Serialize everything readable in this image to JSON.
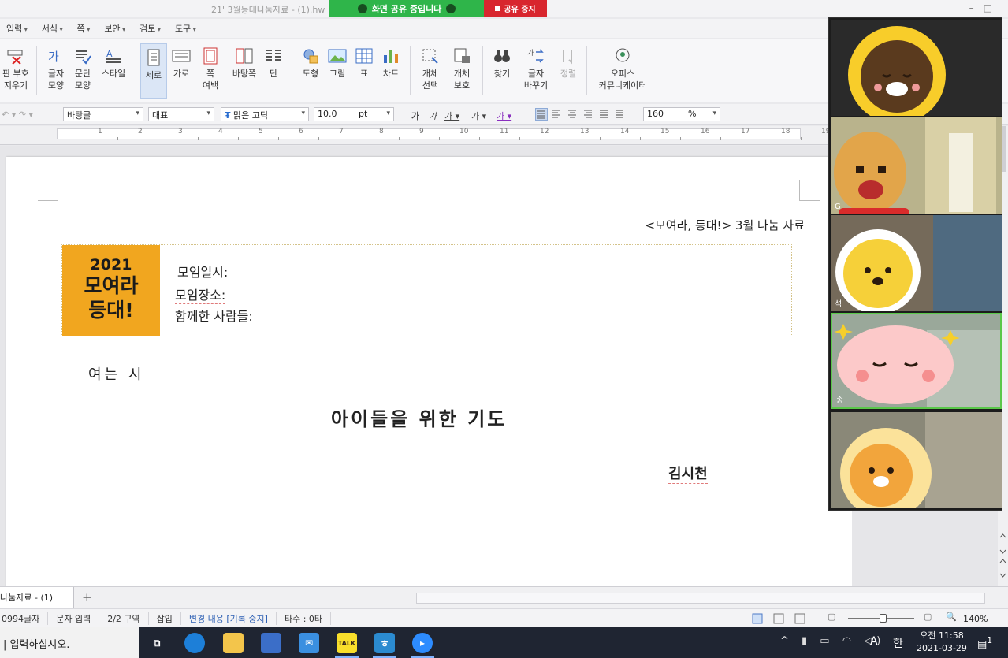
{
  "titlebar": {
    "doc_title": "21' 3월등대나눔자료 - (1).hw",
    "share_status": "화면 공유 중입니다",
    "share_stop": "공유 중지"
  },
  "menu": [
    "입력",
    "서식",
    "쪽",
    "보안",
    "검토",
    "도구"
  ],
  "ribbon": {
    "clear_marks": [
      "판 부호",
      "지우기"
    ],
    "char_shape": [
      "글자",
      "모양"
    ],
    "para_shape": [
      "문단",
      "모양"
    ],
    "style": "스타일",
    "portrait": "세로",
    "landscape": "가로",
    "margins": [
      "쪽",
      "여백"
    ],
    "master_page": "바탕쪽",
    "columns": "단",
    "shapes": "도형",
    "picture": "그림",
    "table": "표",
    "chart": "차트",
    "select_obj": [
      "개체",
      "선택"
    ],
    "protect_obj": [
      "개체",
      "보호"
    ],
    "find": "찾기",
    "replace": [
      "글자",
      "바꾸기"
    ],
    "sort": "정렬",
    "office": [
      "오피스",
      "커뮤니케이터"
    ]
  },
  "formatbar": {
    "style_value": "바탕글",
    "language_value": "대표",
    "font_value": "맑은 고딕",
    "font_size": "10.0",
    "size_unit": "pt",
    "zoom_value": "160",
    "zoom_unit": "%"
  },
  "ruler_numbers": [
    "1",
    "2",
    "3",
    "4",
    "5",
    "6",
    "7",
    "8",
    "9",
    "10",
    "11",
    "12",
    "13",
    "14",
    "15",
    "16",
    "17",
    "18",
    "19"
  ],
  "document": {
    "header": "<모여라, 등대!> 3월 나눔 자료",
    "block_year": "2021",
    "block_line1": "모여라",
    "block_line2": "등대!",
    "meeting_date": "모임일시:",
    "meeting_place": "모임장소:",
    "attendees": "함께한 사람들:",
    "opening": "여는 시",
    "poem_title": "아이들을 위한 기도",
    "author": "김시천"
  },
  "video": {
    "tiles": [
      {
        "name": ""
      },
      {
        "name": "G"
      },
      {
        "name": "석"
      },
      {
        "name": "송"
      },
      {
        "name": ""
      }
    ]
  },
  "tabs": {
    "doc_tab": "나눔자료 - (1)",
    "add": "+"
  },
  "status": {
    "char_count": "0994글자",
    "input_mode": "문자 입력",
    "section": "2/2 구역",
    "insert": "삽입",
    "track_changes": "변경 내용 [기록 중지]",
    "typing_speed": "타수 : 0타",
    "zoom": "140%"
  },
  "taskbar": {
    "search_placeholder": "입력하십시오.",
    "kakao": "TALK",
    "ime_mode": "A",
    "ime_lang": "한",
    "clock_time": "오전 11:58",
    "clock_date": "2021-03-29",
    "notifications": "1"
  },
  "colors": {
    "orange_block": "#f1a61f",
    "share_green": "#2fb54a",
    "share_red": "#d8262e",
    "taskbar": "#1f2532"
  }
}
